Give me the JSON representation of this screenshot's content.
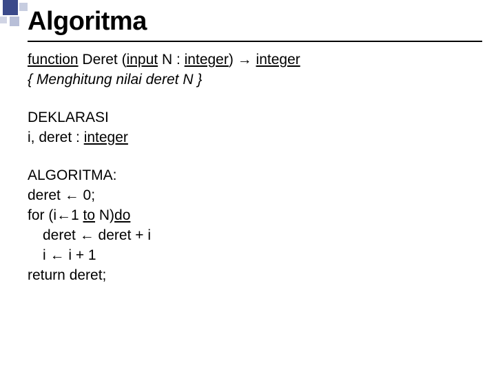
{
  "title": "Algoritma",
  "sig": {
    "kw_function": "function",
    "name": " Deret (",
    "kw_input": "input",
    "param": " N : ",
    "type1": "integer",
    "close": ") → ",
    "type2": "integer"
  },
  "comment": "{ Menghitung nilai deret N }",
  "dek": {
    "heading": "DEKLARASI",
    "vars_pre": "i, deret : ",
    "vars_type": "integer"
  },
  "alg": {
    "heading": "ALGORITMA:",
    "l1": "deret ← 0;",
    "l2_a": "for (i←1 ",
    "l2_to": "to",
    "l2_b": " N)",
    "l2_do": "do",
    "l3": "deret ← deret + i",
    "l4": "i ← i + 1",
    "l5": "return deret;"
  }
}
